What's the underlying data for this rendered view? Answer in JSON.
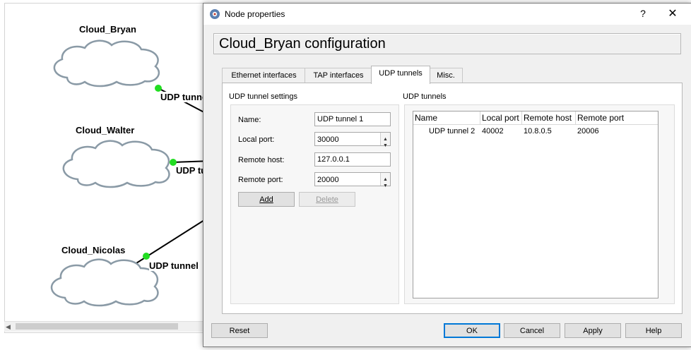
{
  "topology": {
    "nodes": [
      {
        "label": "Cloud_Bryan"
      },
      {
        "label": "Cloud_Walter"
      },
      {
        "label": "Cloud_Nicolas"
      }
    ],
    "links": [
      {
        "label": "UDP tunnel"
      },
      {
        "label": "UDP tu"
      },
      {
        "label": "UDP tunnel"
      }
    ]
  },
  "dialog": {
    "title": "Node properties",
    "help_label": "?",
    "close_label": "✕",
    "header": "Cloud_Bryan configuration",
    "tabs": [
      {
        "label": "Ethernet interfaces",
        "active": false
      },
      {
        "label": "TAP interfaces",
        "active": false
      },
      {
        "label": "UDP tunnels",
        "active": true
      },
      {
        "label": "Misc.",
        "active": false
      }
    ],
    "settings": {
      "group_title": "UDP tunnel settings",
      "name_label": "Name:",
      "name_value": "UDP tunnel 1",
      "local_port_label": "Local port:",
      "local_port_value": "30000",
      "remote_host_label": "Remote host:",
      "remote_host_value": "127.0.0.1",
      "remote_port_label": "Remote port:",
      "remote_port_value": "20000",
      "add_label": "Add",
      "delete_label": "Delete"
    },
    "tunnels": {
      "group_title": "UDP tunnels",
      "columns": [
        "Name",
        "Local port",
        "Remote host",
        "Remote port"
      ],
      "rows": [
        {
          "name": "UDP tunnel 2",
          "local_port": "40002",
          "remote_host": "10.8.0.5",
          "remote_port": "20006"
        }
      ]
    },
    "buttons": {
      "reset": "Reset",
      "ok": "OK",
      "cancel": "Cancel",
      "apply": "Apply",
      "help": "Help"
    }
  },
  "colors": {
    "link_dot": "#22dd22",
    "cloud_stroke": "#8a9aa6",
    "accent": "#0078d7"
  }
}
